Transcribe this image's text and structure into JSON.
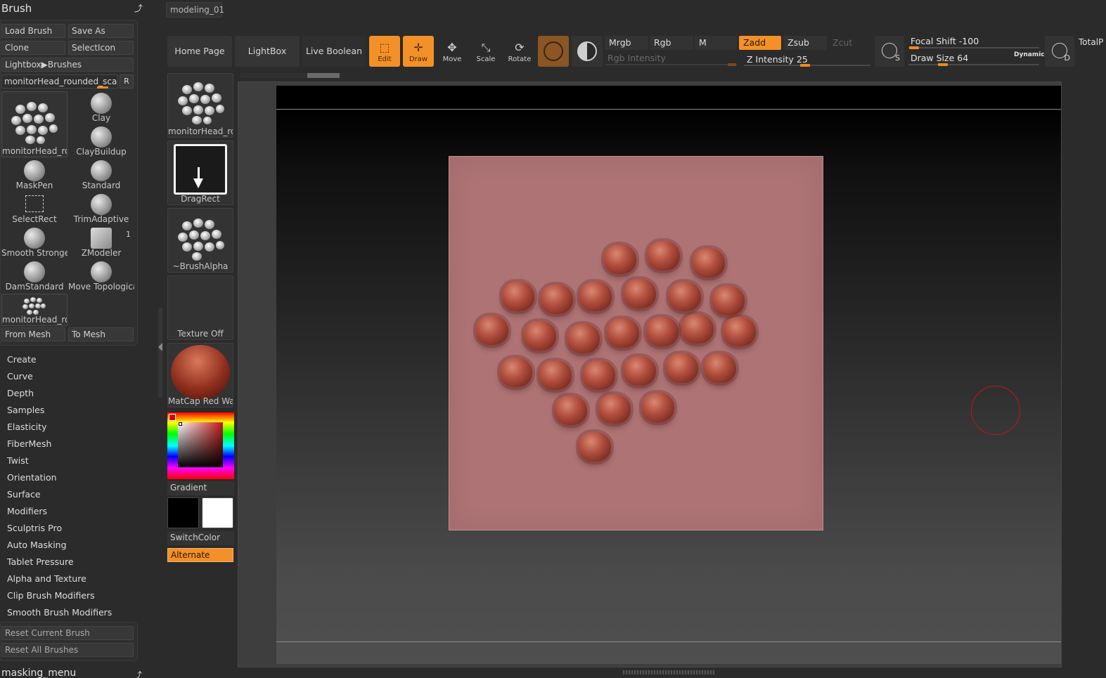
{
  "brush_palette": {
    "title": "Brush",
    "buttons": {
      "load_brush": "Load Brush",
      "save_as": "Save As",
      "clone": "Clone",
      "select_icon": "SelectIcon",
      "lightbox_brushes": "Lightbox▶Brushes",
      "from_mesh": "From Mesh",
      "to_mesh": "To Mesh"
    },
    "current_brush_name": "monitorHead_rounded_scales",
    "r_button": "R",
    "brushes": [
      {
        "label": "monitorHead_ro"
      },
      {
        "label": "Clay"
      },
      {
        "label": "ClayBuildup"
      },
      {
        "label": "MaskPen"
      },
      {
        "label": "Standard"
      },
      {
        "label": "SelectRect"
      },
      {
        "label": "TrimAdaptive"
      },
      {
        "label": "Smooth Stronger"
      },
      {
        "label": "ZModeler"
      },
      {
        "label": "DamStandard"
      },
      {
        "label": "Move Topologica"
      },
      {
        "label": "monitorHead_ro"
      }
    ],
    "zmodeler_badge": "1",
    "submenus": [
      "Create",
      "Curve",
      "Depth",
      "Samples",
      "Elasticity",
      "FiberMesh",
      "Twist",
      "Orientation",
      "Surface",
      "Modifiers",
      "Sculptris Pro",
      "Auto Masking",
      "Tablet Pressure",
      "Alpha and Texture",
      "Clip Brush Modifiers",
      "Smooth Brush Modifiers"
    ],
    "reset_current": "Reset Current Brush",
    "reset_all": "Reset All Brushes"
  },
  "masking_menu": {
    "title": "masking_menu"
  },
  "document_tab": "modeling_01",
  "top_bar": {
    "home_page": "Home Page",
    "lightbox": "LightBox",
    "live_boolean": "Live Boolean",
    "tools": {
      "edit": "Edit",
      "draw": "Draw",
      "move": "Move",
      "scale": "Scale",
      "rotate": "Rotate"
    },
    "modes": {
      "mrgb": "Mrgb",
      "rgb": "Rgb",
      "m": "M",
      "zadd": "Zadd",
      "zsub": "Zsub",
      "zcut": "Zcut"
    },
    "rgb_intensity_label": "Rgb Intensity",
    "z_intensity_label": "Z Intensity",
    "z_intensity_value": "25",
    "focal_shift_label": "Focal Shift",
    "focal_shift_value": "-100",
    "draw_size_label": "Draw Size",
    "draw_size_value": "64",
    "dynamic": "Dynamic",
    "lazy_s": "S",
    "lazy_d": "D",
    "total_points": "TotalP"
  },
  "tool_palette": {
    "current_brush": "monitorHead_ro",
    "stroke": "DragRect",
    "alpha": "~BrushAlpha",
    "texture": "Texture Off",
    "material": "MatCap Red Wax",
    "gradient": "Gradient",
    "switch_color": "SwitchColor",
    "alternate": "Alternate"
  },
  "colors": {
    "accent": "#f39028",
    "plane": "#ad7375",
    "scales": "#b24f3e",
    "cursor": "#c0141a"
  }
}
